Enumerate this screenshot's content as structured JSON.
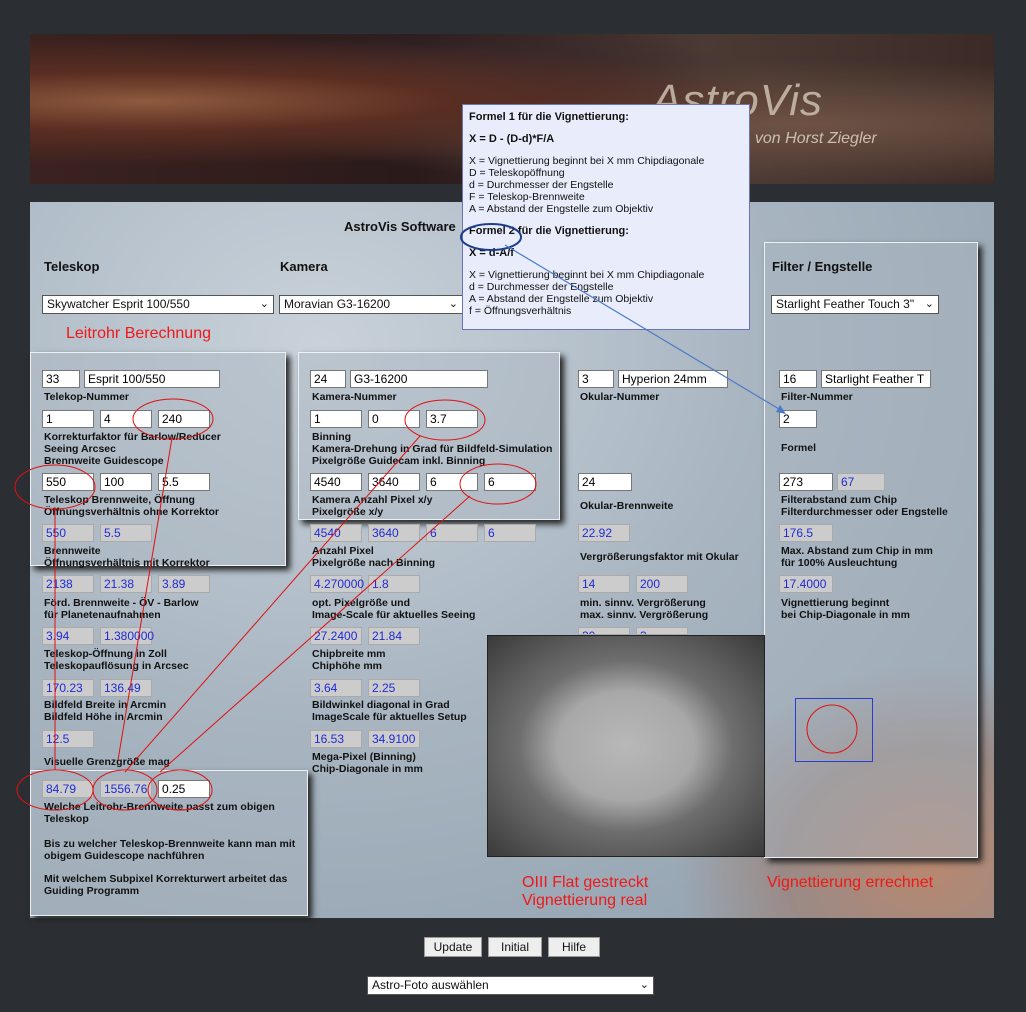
{
  "banner": {
    "title": "AstroVis",
    "subtitle": "ie von Horst Ziegler"
  },
  "software_title": "AstroVis Software",
  "tooltip": {
    "f1_title": "Formel 1 für die Vignettierung:",
    "f1_formula": "X = D - (D-d)*F/A",
    "f1_lines": [
      "X = Vignettierung beginnt bei X mm Chipdiagonale",
      "D = Teleskopöffnung",
      "d = Durchmesser der Engstelle",
      "F = Teleskop-Brennweite",
      "A = Abstand der Engstelle zum Objektiv"
    ],
    "f2_title": "Formel 2 für die Vignettierung:",
    "f2_formula": "X = d-A/f",
    "f2_lines": [
      "X = Vignettierung beginnt bei X mm Chipdiagonale",
      "d = Durchmesser der Engstelle",
      "A = Abstand der Engstelle zum Objektiv",
      "f = Öffnungsverhältnis"
    ]
  },
  "sections": {
    "teleskop": "Teleskop",
    "kamera": "Kamera",
    "filter": "Filter / Engstelle"
  },
  "selects": {
    "teleskop": "Skywatcher Esprit 100/550",
    "kamera": "Moravian G3-16200",
    "filter": "Starlight Feather Touch 3\"",
    "foto": "Astro-Foto auswählen"
  },
  "notes": {
    "leitrohr": "Leitrohr Berechnung",
    "flat": "OIII Flat gestreckt",
    "flat2": "Vignettierung real",
    "vign": "Vignettierung errechnet"
  },
  "tel": {
    "nr": "33",
    "name": "Esprit 100/550",
    "nr_label": "Telekop-Nummer",
    "korr": "1",
    "seeing": "4",
    "guide_bw": "240",
    "l1": "Korrekturfaktor für Barlow/Reducer",
    "l2": "Seeing Arcsec",
    "l3": "Brennweite Guidescope",
    "bw": "550",
    "oeff": "100",
    "ov": "5.5",
    "l4": "Teleskop Brennweite, Öffnung",
    "l5": "Öffnungsverhältnis ohne Korrektor",
    "bw2": "550",
    "ov2": "5.5",
    "l6": "Brennweite",
    "l7": "Öffnungsverhältnis mit Korrektor",
    "fb1": "2138",
    "fb2": "21.38",
    "fb3": "3.89",
    "l8": "Förd. Brennweite - ÖV - Barlow",
    "l9": "für Planetenaufnahmen",
    "z1": "3.94",
    "z2": "1.380000",
    "l10": "Teleskop-Öffnung in Zoll",
    "l11": "Teleskopauflösung in Arcsec",
    "bf1": "170.23",
    "bf2": "136.49",
    "l12": "Bildfeld Breite in Arcmin",
    "l13": "Bildfeld Höhe in Arcmin",
    "vg": "12.5",
    "l14": "Visuelle Grenzgröße mag"
  },
  "guide": {
    "v1": "84.79",
    "v2": "1556.76",
    "v3": "0.25",
    "l1": "Welche Leitrohr-Brennweite passt zum obigen",
    "l2": "Teleskop",
    "l3": "Bis zu welcher Teleskop-Brennweite kann man mit",
    "l4": "obigem Guidescope nachführen",
    "l5": "Mit welchem Subpixel Korrekturwert arbeitet das",
    "l6": "Guiding Programm"
  },
  "kam": {
    "nr": "24",
    "name": "G3-16200",
    "nr_label": "Kamera-Nummer",
    "bin": "1",
    "dreh": "0",
    "pix_guide": "3.7",
    "l1": "Binning",
    "l2": "Kamera-Drehung in Grad für Bildfeld-Simulation",
    "l3": "Pixelgröße Guidecam inkl. Binning",
    "px": "4540",
    "py": "3640",
    "sx": "6",
    "sy": "6",
    "l4": "Kamera Anzahl Pixel x/y",
    "l5": "Pixelgröße x/y",
    "a1": "4540",
    "a2": "3640",
    "a3": "6",
    "a4": "6",
    "l6": "Anzahl Pixel",
    "l7": "Pixelgröße nach Binning",
    "o1": "4.270000",
    "o2": "1.8",
    "l8": "opt. Pixelgröße und",
    "l9": "Image-Scale für aktuelles Seeing",
    "c1": "27.2400",
    "c2": "21.84",
    "l10": "Chipbreite mm",
    "l11": "Chiphöhe mm",
    "w1": "3.64",
    "w2": "2.25",
    "l12": "Bildwinkel diagonal in Grad",
    "l13": "ImageScale für aktuelles Setup",
    "m1": "16.53",
    "m2": "34.9100",
    "l14": "Mega-Pixel (Binning)",
    "l15": "Chip-Diagonale in mm"
  },
  "okular": {
    "nr": "3",
    "name": "Hyperion 24mm",
    "nr_label": "Okular-Nummer",
    "bw": "24",
    "l1": "Okular-Brennweite",
    "vf": "22.92",
    "l2": "Vergrößerungsfaktor mit Okular",
    "v1": "14",
    "v2": "200",
    "l3": "min. sinnv. Vergrößerung",
    "l4": "max. sinnv. Vergrößerung",
    "v3": "30",
    "v4": "3"
  },
  "filter": {
    "nr": "16",
    "name": "Starlight Feather T",
    "nr_label": "Filter-Nummer",
    "formel": "2",
    "l_formel": "Formel",
    "abst": "273",
    "durch": "67",
    "l1": "Filterabstand zum Chip",
    "l2": "Filterdurchmesser oder Engstelle",
    "max": "176.5",
    "l3": "Max. Abstand zum Chip in mm",
    "l4": "für 100% Ausleuchtung",
    "vig": "17.4000",
    "l5": "Vignettierung beginnt",
    "l6": "bei Chip-Diagonale in mm"
  },
  "buttons": {
    "update": "Update",
    "initial": "Initial",
    "hilfe": "Hilfe"
  },
  "icons": {
    "chevron": "chevron-down-icon"
  }
}
